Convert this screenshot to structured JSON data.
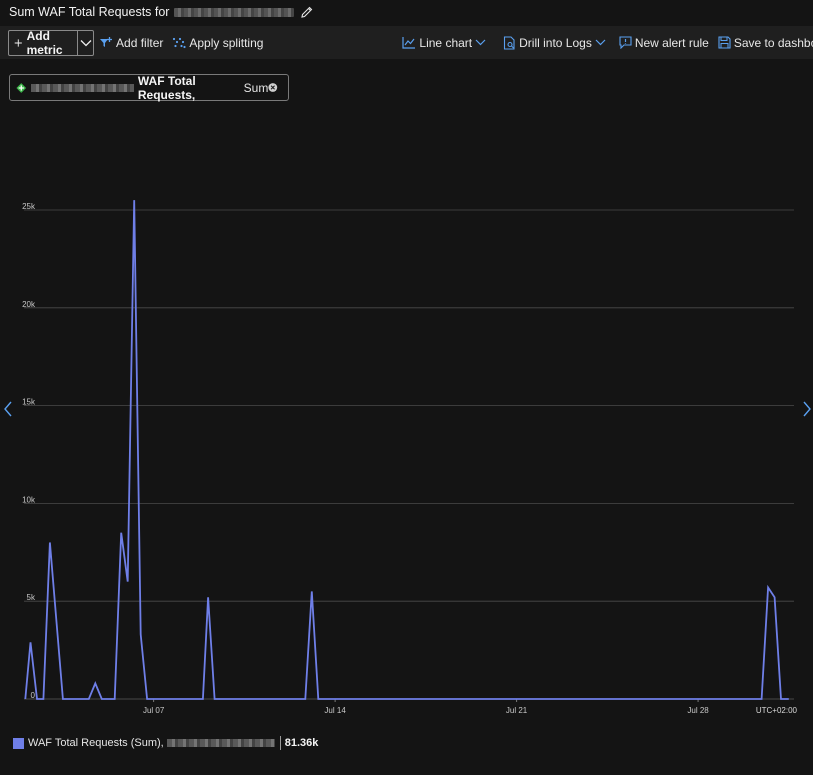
{
  "header": {
    "title": "Sum WAF Total Requests for"
  },
  "toolbar": {
    "add_metric": "Add metric",
    "add_filter": "Add filter",
    "apply_splitting": "Apply splitting",
    "line_chart": "Line chart",
    "drill_into_logs": "Drill into Logs",
    "new_alert_rule": "New alert rule",
    "save_to_dashboard": "Save to dashboard"
  },
  "metric_pill": {
    "name": "WAF Total Requests,",
    "aggregation": "Sum"
  },
  "legend": {
    "label": "WAF Total Requests (Sum),",
    "total": "81.36k"
  },
  "colors": {
    "series": "#6f7fe8",
    "background": "#141414",
    "grid": "#4a4a4a"
  },
  "chart_data": {
    "type": "line",
    "xlabel": "",
    "ylabel": "",
    "y_ticks": [
      0,
      5000,
      10000,
      15000,
      20000,
      25000
    ],
    "y_tick_labels": [
      "0",
      "5k",
      "10k",
      "15k",
      "20k",
      "25k"
    ],
    "ylim": [
      0,
      25000
    ],
    "x_ticks": [
      7,
      14,
      21,
      28
    ],
    "x_tick_labels": [
      "Jul 07",
      "Jul 14",
      "Jul 21",
      "Jul 28"
    ],
    "xlim": [
      2.0,
      31.7
    ],
    "timezone_label": "UTC+02:00",
    "grid": true,
    "series": [
      {
        "values": [
          [
            2.05,
            0
          ],
          [
            2.25,
            2900
          ],
          [
            2.5,
            0
          ],
          [
            2.75,
            0
          ],
          [
            3.0,
            8000
          ],
          [
            3.5,
            0
          ],
          [
            4.0,
            0
          ],
          [
            4.5,
            0
          ],
          [
            4.75,
            800
          ],
          [
            5.0,
            0
          ],
          [
            5.5,
            0
          ],
          [
            5.75,
            8500
          ],
          [
            6.0,
            6000
          ],
          [
            6.25,
            25500
          ],
          [
            6.5,
            3300
          ],
          [
            6.75,
            0
          ],
          [
            8.0,
            0
          ],
          [
            8.25,
            0
          ],
          [
            8.5,
            0
          ],
          [
            8.9,
            0
          ],
          [
            9.1,
            5200
          ],
          [
            9.35,
            0
          ],
          [
            11.0,
            0
          ],
          [
            12.85,
            0
          ],
          [
            13.1,
            5500
          ],
          [
            13.35,
            0
          ],
          [
            20.0,
            0
          ],
          [
            28.0,
            0
          ],
          [
            30.45,
            0
          ],
          [
            30.7,
            5700
          ],
          [
            30.95,
            5200
          ],
          [
            31.2,
            0
          ],
          [
            31.5,
            0
          ]
        ]
      }
    ]
  }
}
